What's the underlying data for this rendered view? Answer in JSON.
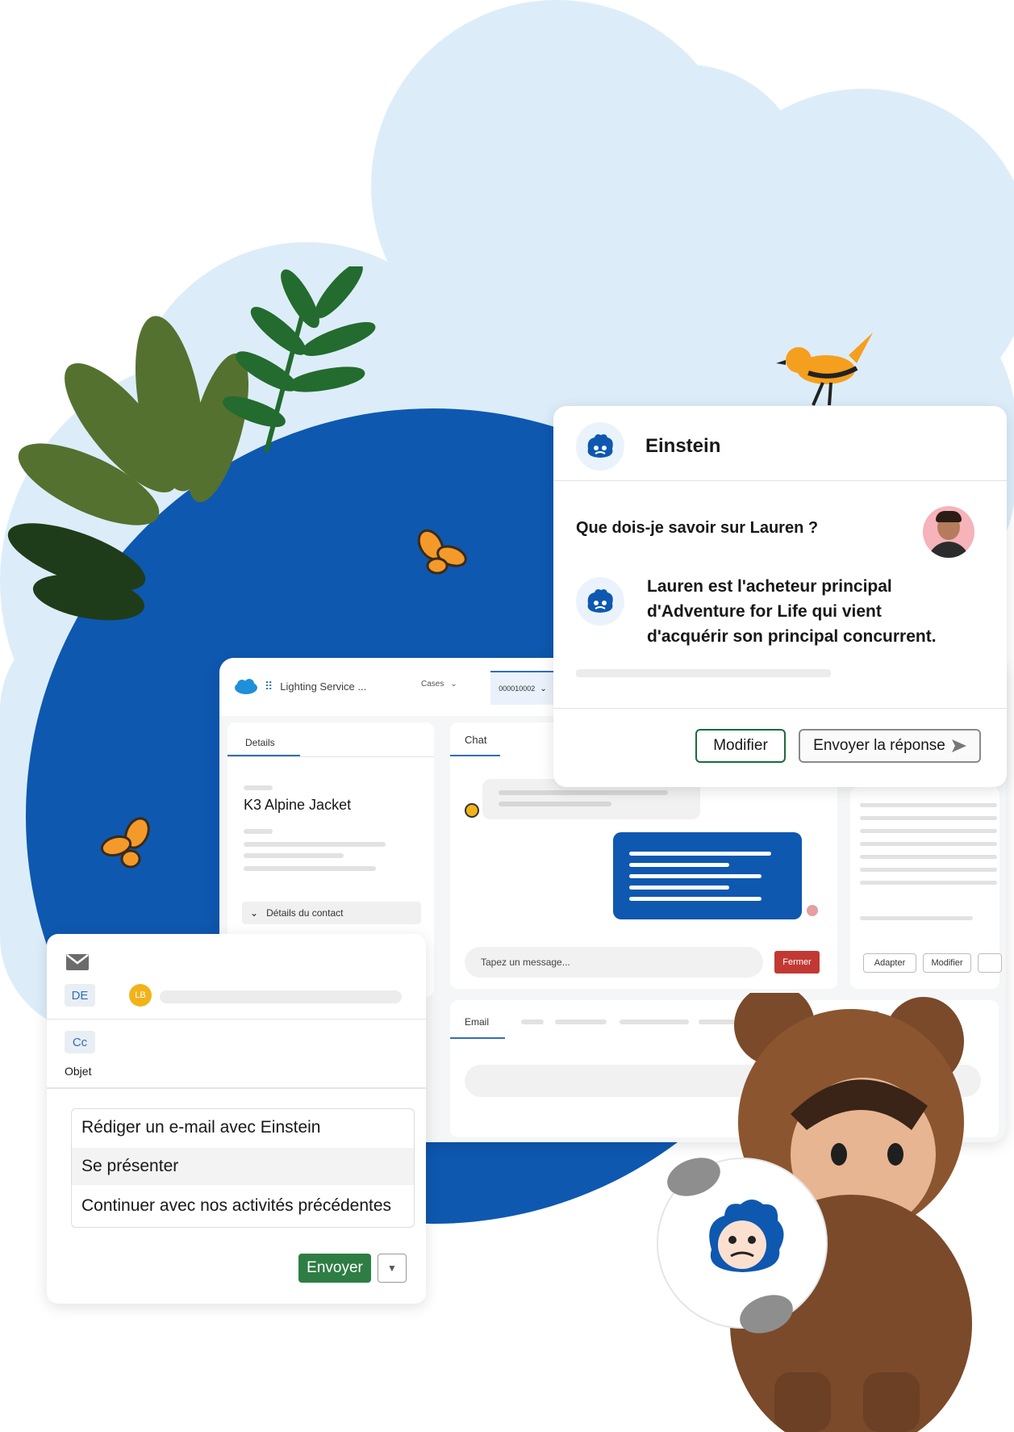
{
  "colors": {
    "brand_blue": "#0e58b0",
    "sky": "#dcedf9",
    "send_green": "#2e7d44",
    "close_red": "#c23934",
    "avatar_gold": "#f2b31a"
  },
  "einstein_card": {
    "title": "Einstein",
    "question": "Que dois-je savoir sur Lauren ?",
    "answer_lines": [
      "Lauren est l'acheteur principal",
      "d'Adventure for Life qui vient",
      "d'acquérir son principal concurrent."
    ],
    "edit_label": "Modifier",
    "send_reply_label": "Envoyer la réponse"
  },
  "console": {
    "app_name": "Lighting Service ...",
    "nav_cases": "Cases",
    "case_tab": "000010002",
    "details_tab": "Details",
    "record_title": "K3 Alpine Jacket",
    "contact_section": "Détails du contact",
    "chat_tab": "Chat",
    "message_placeholder": "Tapez un message...",
    "close_label": "Fermer",
    "adapt_label": "Adapter",
    "modify_label": "Modifier",
    "email_tab": "Email"
  },
  "email_composer": {
    "from_label": "DE",
    "from_avatar": "LB",
    "cc_label": "Cc",
    "subject_label": "Objet",
    "suggestions": [
      "Rédiger un e-mail avec Einstein",
      "Se présenter",
      "Continuer avec nos activités précédentes"
    ],
    "send_label": "Envoyer"
  },
  "icons": [
    "einstein-icon",
    "salesforce-cloud-icon",
    "app-launcher-icon",
    "mail-icon",
    "send-arrow-icon",
    "chevron-down-icon",
    "butterfly-icon",
    "bird-icon",
    "astro-mascot"
  ]
}
